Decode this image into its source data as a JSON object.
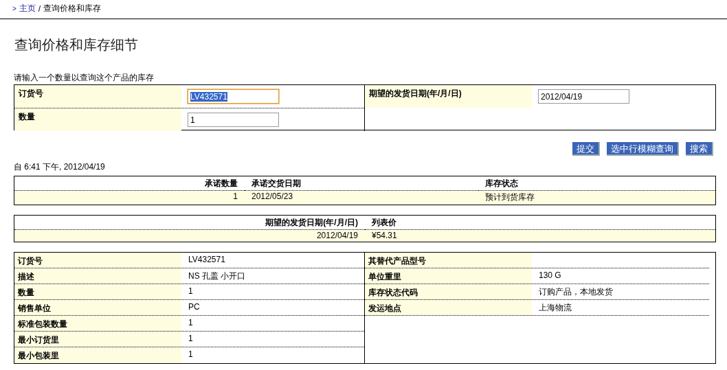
{
  "breadcrumb": {
    "marker": ">",
    "home": "主页",
    "separator": "/",
    "current": "查询价格和库存"
  },
  "title": "查询价格和库存细节",
  "instruction": "请输入一个数量以查询这个产品的库存",
  "form": {
    "left": [
      {
        "label": "订货号",
        "value": "LV432571",
        "focused": true
      },
      {
        "label": "数量",
        "value": "1",
        "focused": false
      }
    ],
    "right": [
      {
        "label": "期望的发货日期(年/月/日)",
        "value": "2012/04/19",
        "focused": false
      }
    ]
  },
  "buttons": [
    "提交",
    "选中行模糊查询",
    "搜索"
  ],
  "timestamp": "自 6:41 下午, 2012/04/19",
  "availability_table": {
    "columns": [
      "承诺数量",
      "承诺交货日期",
      "库存状态"
    ],
    "rows": [
      [
        "1",
        "2012/05/23",
        "预计到货库存"
      ]
    ]
  },
  "price_table": {
    "columns": [
      "期望的发货日期(年/月/日)",
      "列表价"
    ],
    "rows": [
      [
        "2012/04/19",
        "¥54.31"
      ]
    ]
  },
  "details": {
    "left": [
      {
        "label": "订货号",
        "value": "LV432571"
      },
      {
        "label": "描述",
        "value": "NS 孔盖 小开口"
      },
      {
        "label": "数量",
        "value": "1"
      },
      {
        "label": "销售单位",
        "value": "PC"
      },
      {
        "label": "标准包装数量",
        "value": "1"
      },
      {
        "label": "最小订货里",
        "value": "1"
      },
      {
        "label": "最小包装里",
        "value": "1"
      }
    ],
    "right": [
      {
        "label": "其替代产品型号"
      },
      {
        "label": "单位重里",
        "value": "130 G"
      },
      {
        "label": "库存状态代码",
        "value": "订购产品，本地发货"
      },
      {
        "label": "发运地点",
        "value": "上海物流"
      }
    ]
  }
}
